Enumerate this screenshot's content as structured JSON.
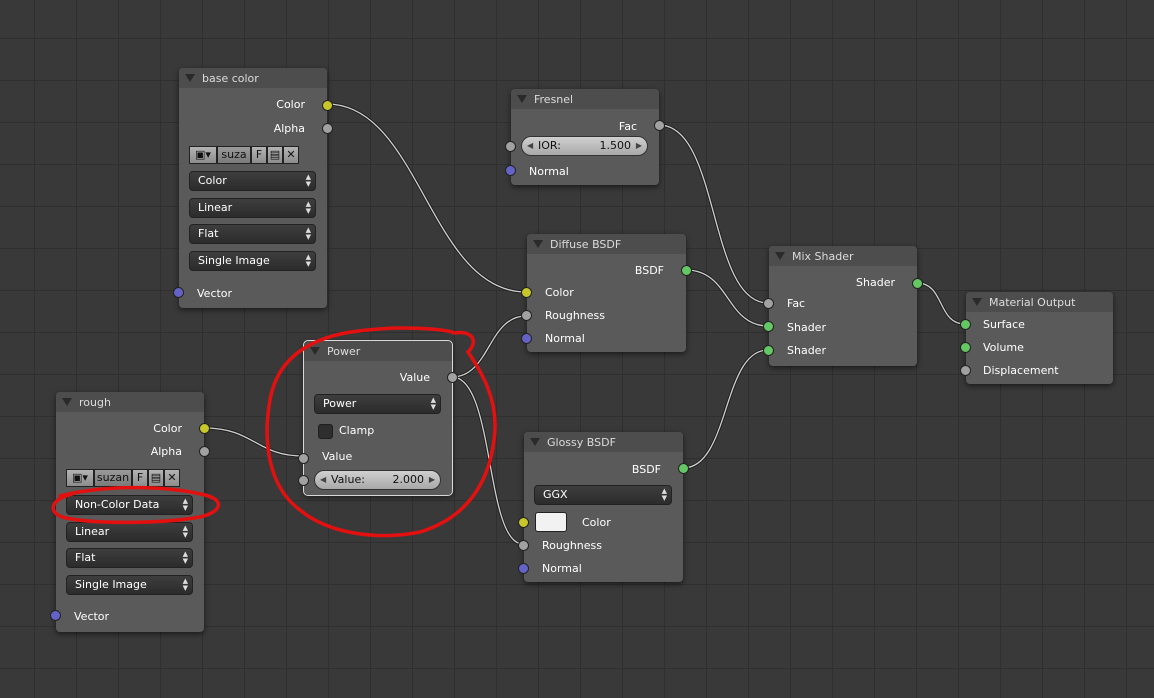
{
  "nodes": {
    "base_color": {
      "title": "base color",
      "outputs": [
        "Color",
        "Alpha"
      ],
      "image_name": "suza",
      "fake_user": "F",
      "dropdowns": [
        "Color",
        "Linear",
        "Flat",
        "Single Image"
      ],
      "input": "Vector"
    },
    "rough": {
      "title": "rough",
      "outputs": [
        "Color",
        "Alpha"
      ],
      "image_name": "suzan",
      "fake_user": "F",
      "dropdowns": [
        "Non-Color Data",
        "Linear",
        "Flat",
        "Single Image"
      ],
      "input": "Vector"
    },
    "fresnel": {
      "title": "Fresnel",
      "output": "Fac",
      "ior_label": "IOR:",
      "ior_value": "1.500",
      "input": "Normal"
    },
    "diffuse": {
      "title": "Diffuse BSDF",
      "output": "BSDF",
      "inputs": [
        "Color",
        "Roughness",
        "Normal"
      ]
    },
    "power": {
      "title": "Power",
      "output": "Value",
      "operation": "Power",
      "clamp_label": "Clamp",
      "input": "Value",
      "value_label": "Value:",
      "value": "2.000"
    },
    "glossy": {
      "title": "Glossy BSDF",
      "output": "BSDF",
      "distribution": "GGX",
      "inputs": [
        "Color",
        "Roughness",
        "Normal"
      ],
      "color_swatch": "#f2f2f2"
    },
    "mix": {
      "title": "Mix Shader",
      "output": "Shader",
      "inputs": [
        "Fac",
        "Shader",
        "Shader"
      ]
    },
    "output": {
      "title": "Material Output",
      "inputs": [
        "Surface",
        "Volume",
        "Displacement"
      ]
    }
  },
  "colors": {
    "socket_color": "#c7c729",
    "socket_float": "#a1a1a1",
    "socket_shader": "#63c763",
    "socket_vector": "#6363c7",
    "annotation": "#e41010"
  }
}
